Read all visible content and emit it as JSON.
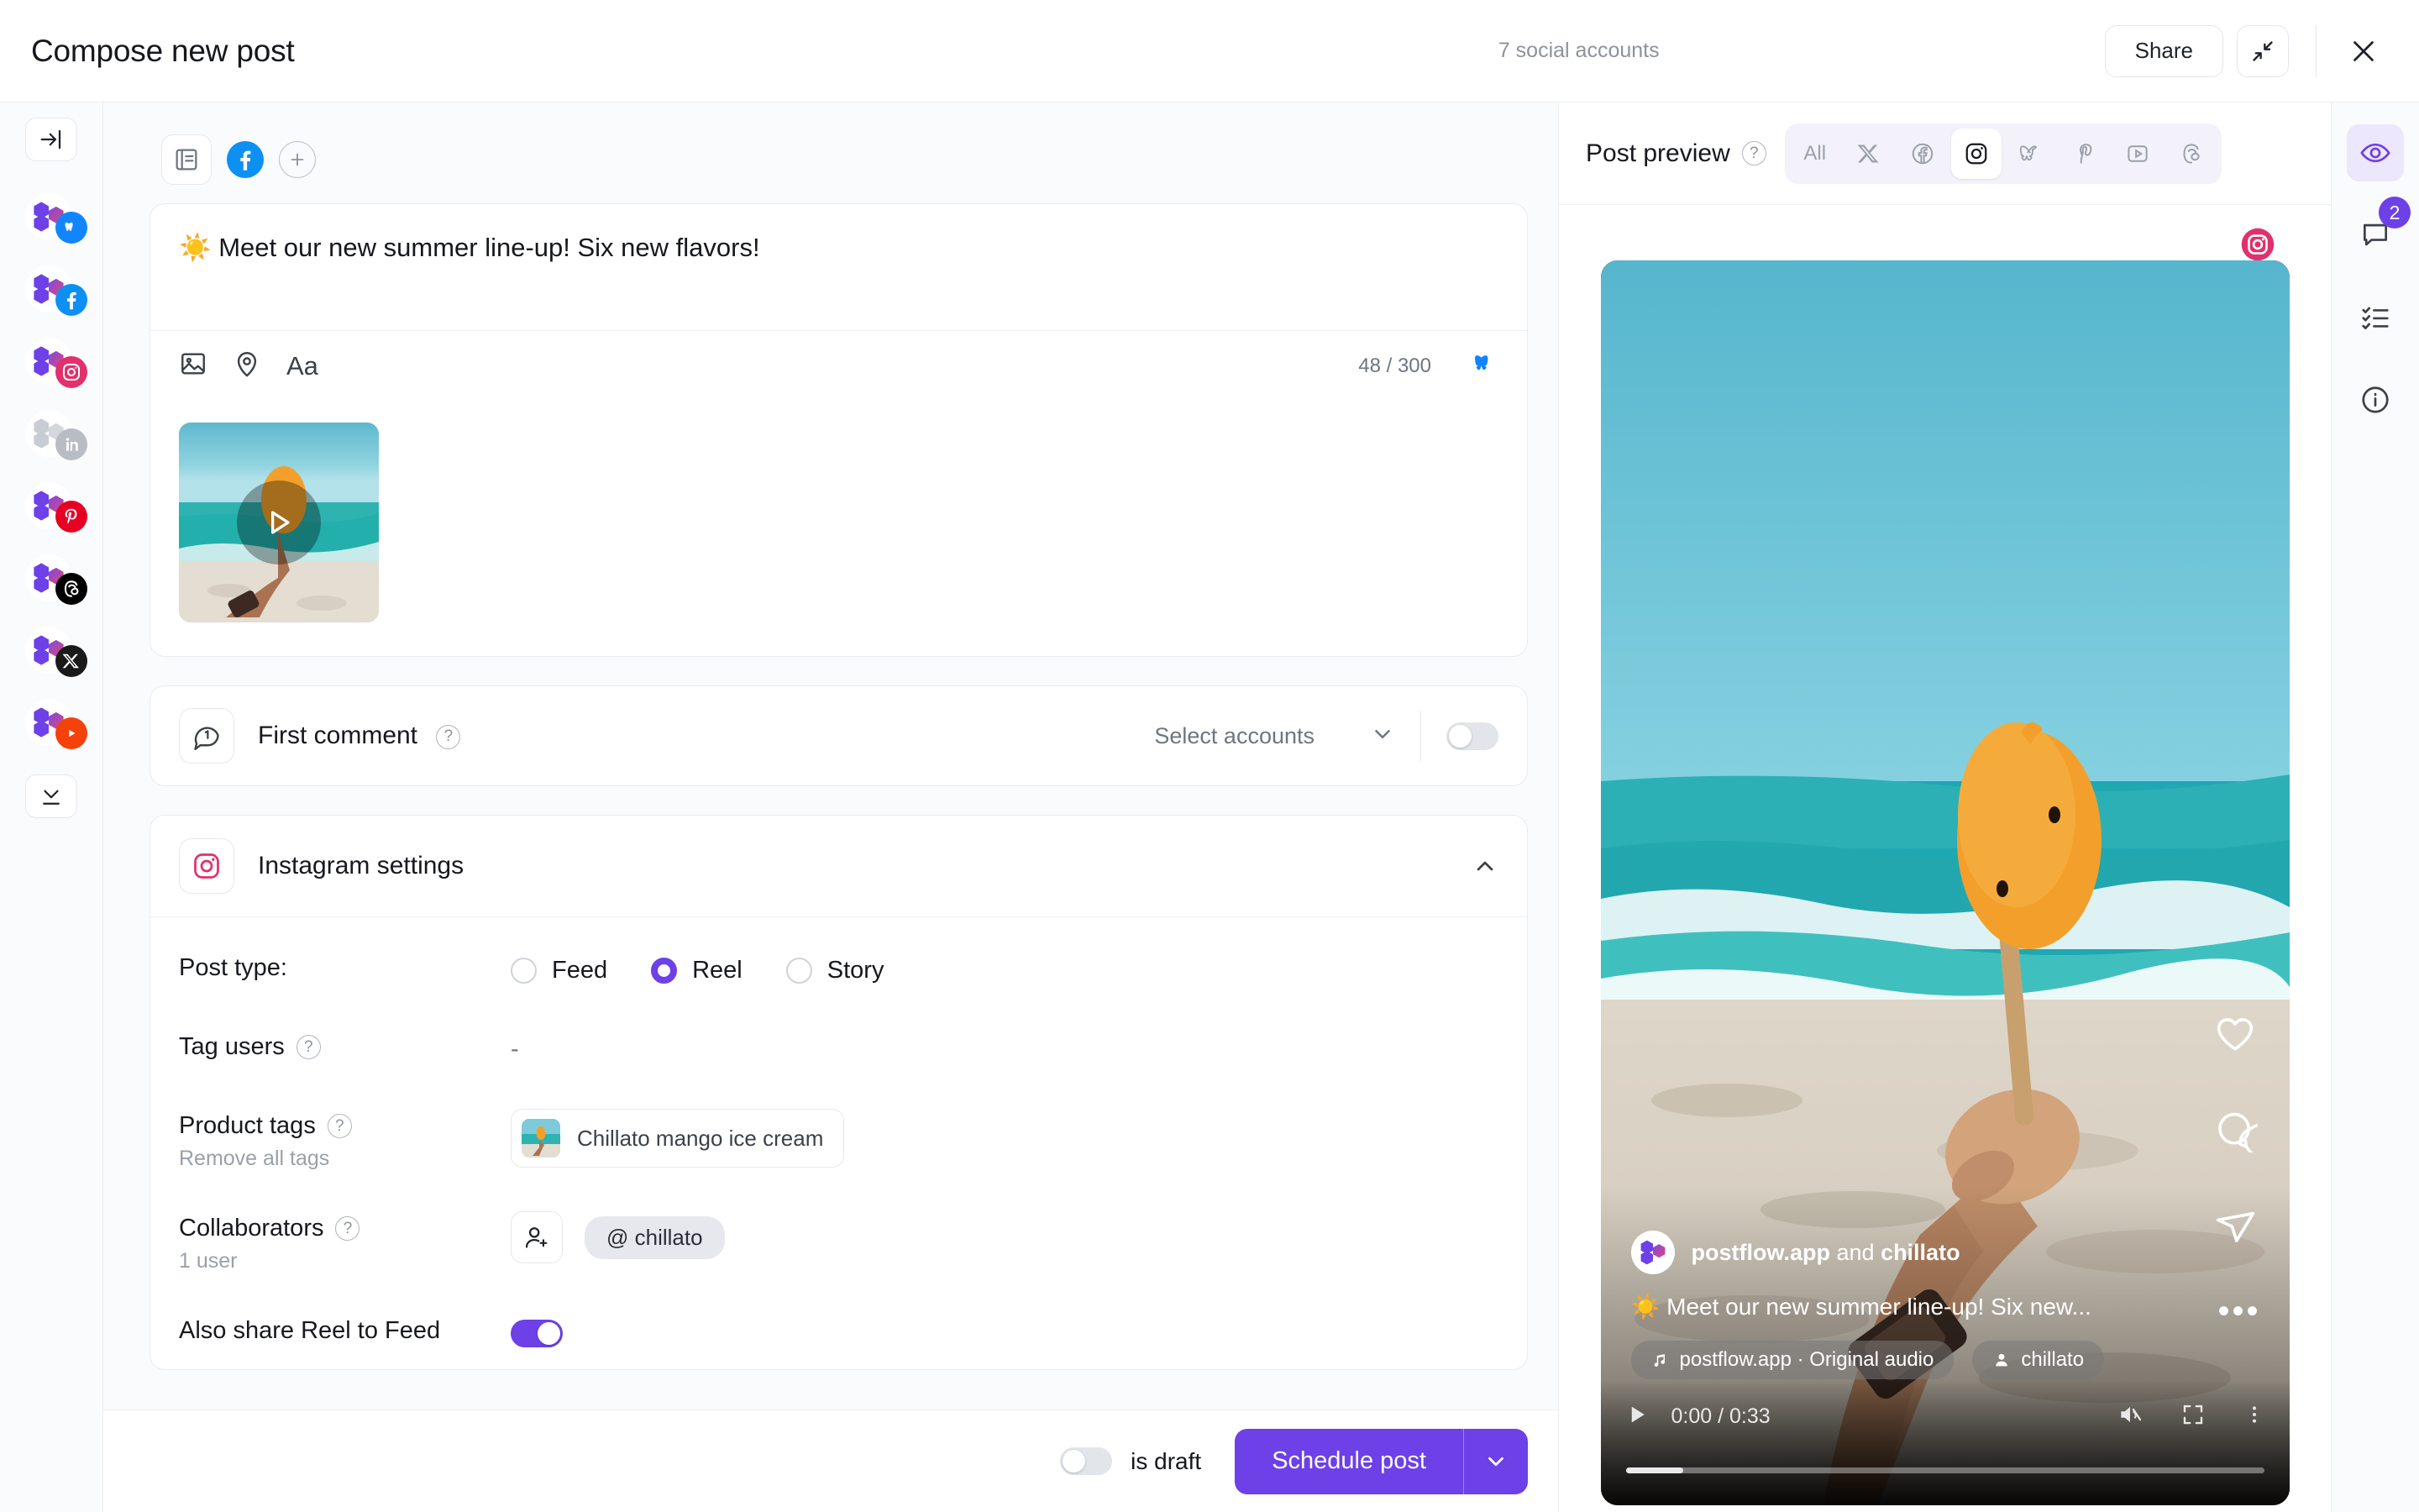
{
  "header": {
    "title": "Compose new post",
    "accounts_count": "7 social accounts",
    "share_label": "Share",
    "collapse_icon": "collapse-diagonal-icon",
    "close_icon": "close-icon"
  },
  "rail": {
    "collapse_icon": "panel-collapse-icon",
    "more_icon": "chevron-down-line-icon",
    "accounts": [
      {
        "platform": "bluesky",
        "enabled": true
      },
      {
        "platform": "facebook",
        "enabled": true
      },
      {
        "platform": "instagram",
        "enabled": true
      },
      {
        "platform": "linkedin",
        "enabled": false
      },
      {
        "platform": "pinterest",
        "enabled": true
      },
      {
        "platform": "threads",
        "enabled": true
      },
      {
        "platform": "x",
        "enabled": true
      },
      {
        "platform": "youtube",
        "enabled": true
      }
    ]
  },
  "composer": {
    "tabs": [
      {
        "name": "global-content-tab",
        "icon": "document-icon"
      },
      {
        "name": "facebook-tab",
        "icon": "facebook-icon"
      },
      {
        "name": "add-variant-tab",
        "icon": "plus-icon"
      }
    ],
    "editor_text": "☀️ Meet our new summer line-up! Six new flavors!",
    "toolbar": {
      "image_icon": "image-icon",
      "location_icon": "location-pin-icon",
      "text_format_label": "Aa",
      "counter": "48 / 300",
      "counter_platform_icon": "bluesky-icon"
    },
    "media": {
      "type": "video",
      "play_icon": "play-icon"
    }
  },
  "first_comment": {
    "icon": "comment-number-one-icon",
    "label": "First comment",
    "help_icon": "help-icon",
    "select_placeholder": "Select accounts",
    "chevron_icon": "chevron-down-icon",
    "enabled": false
  },
  "instagram_settings": {
    "icon": "instagram-icon",
    "title": "Instagram settings",
    "collapse_icon": "chevron-up-icon",
    "post_type": {
      "label": "Post type:",
      "options": [
        "Feed",
        "Reel",
        "Story"
      ],
      "selected": "Reel"
    },
    "tag_users": {
      "label": "Tag users",
      "help_icon": "help-icon",
      "value": "-"
    },
    "product_tags": {
      "label": "Product tags",
      "help_icon": "help-icon",
      "sub": "Remove all tags",
      "chip": "Chillato mango ice cream"
    },
    "collaborators": {
      "label": "Collaborators",
      "help_icon": "help-icon",
      "sub": "1 user",
      "add_icon": "add-user-icon",
      "chip": "@ chillato"
    },
    "share_reel": {
      "label": "Also share Reel to Feed",
      "enabled": true
    }
  },
  "footer": {
    "draft_label": "is draft",
    "draft_enabled": false,
    "schedule_label": "Schedule post",
    "caret_icon": "chevron-down-icon"
  },
  "preview": {
    "title": "Post preview",
    "help_icon": "help-icon",
    "tabs": [
      {
        "label": "All",
        "name": "tab-all",
        "icon": "text",
        "active": false
      },
      {
        "label": "",
        "name": "tab-x",
        "icon": "x-icon",
        "active": false
      },
      {
        "label": "",
        "name": "tab-facebook",
        "icon": "facebook-icon",
        "active": false
      },
      {
        "label": "",
        "name": "tab-instagram",
        "icon": "instagram-icon",
        "active": true
      },
      {
        "label": "",
        "name": "tab-bluesky",
        "icon": "bluesky-icon",
        "active": false
      },
      {
        "label": "",
        "name": "tab-pinterest",
        "icon": "pinterest-icon",
        "active": false
      },
      {
        "label": "",
        "name": "tab-youtube",
        "icon": "youtube-icon",
        "active": false
      },
      {
        "label": "",
        "name": "tab-threads",
        "icon": "threads-icon",
        "active": false
      }
    ],
    "platform_badge": "instagram-icon",
    "post": {
      "username": "postflow.app",
      "and_word": " and ",
      "collaborator": "chillato",
      "caption": "☀️ Meet our new summer line-up! Six new...",
      "audio_pill": "postflow.app · Original audio",
      "tag_pill": "chillato",
      "like_icon": "heart-icon",
      "comment_icon": "comment-icon",
      "share_icon": "send-icon",
      "more_icon": "more-horizontal-icon"
    },
    "video": {
      "play_icon": "play-icon",
      "time": "0:00 / 0:33",
      "mute_icon": "volume-muted-icon",
      "fullscreen_icon": "fullscreen-icon",
      "menu_icon": "more-vertical-icon",
      "progress_percent": 9
    }
  },
  "tool_rail": {
    "items": [
      {
        "name": "preview-tool",
        "icon": "eye-icon",
        "active": true,
        "badge": ""
      },
      {
        "name": "comments-tool",
        "icon": "comment-square-icon",
        "active": false,
        "badge": "2"
      },
      {
        "name": "checklist-tool",
        "icon": "checklist-icon",
        "active": false,
        "badge": ""
      },
      {
        "name": "info-tool",
        "icon": "info-icon",
        "active": false,
        "badge": ""
      }
    ]
  },
  "colors": {
    "accent": "#6d40e8",
    "instagram": "#e1306c",
    "facebook": "#0d90f2",
    "bluesky": "#1185fe",
    "pinterest": "#e60023",
    "youtube": "#f5410c",
    "threads": "#000000",
    "x": "#1a1a1a",
    "linkedin": "#b8bcc3"
  }
}
